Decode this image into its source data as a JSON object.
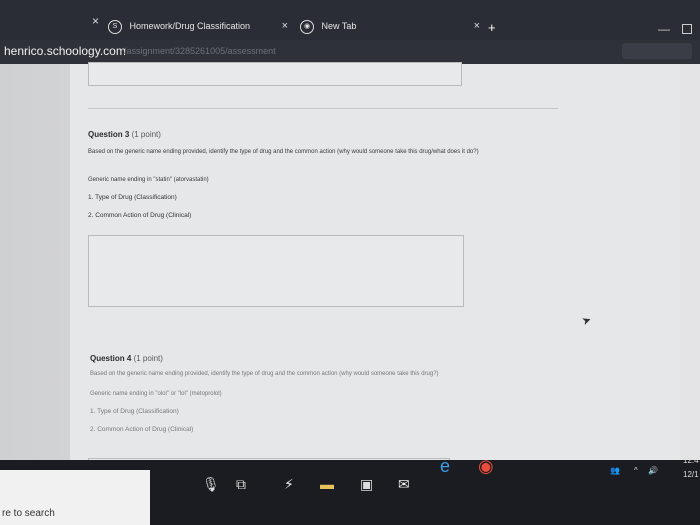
{
  "browser": {
    "tabs": [
      {
        "label": "Homework/Drug Classification",
        "favicon": "S"
      },
      {
        "label": "New Tab",
        "favicon": "◉"
      }
    ],
    "new_tab_symbol": "+",
    "close_symbol": "×",
    "address": {
      "host": "henrico.schoology.com",
      "path": "/assignment/3285261005/assessment"
    }
  },
  "questions": [
    {
      "title": "Question 3",
      "points": "(1 point)",
      "prompt": "Based on the generic name ending provided, identify the type of drug and the common action (why would someone take this drug/what does it do?)",
      "ending": "Generic name ending in \"statin\" (atorvastatin)",
      "items": [
        "1. Type of Drug (Classification)",
        "2. Common Action of Drug (Clinical)"
      ]
    },
    {
      "title": "Question 4",
      "points": "(1 point)",
      "prompt": "Based on the generic name ending provided, identify the type of drug and the common action (why would someone take this drug?)",
      "ending": "Generic name ending in \"olol\" or \"lol\" (metoprolol)",
      "items": [
        "1. Type of Drug (Classification)",
        "2. Common Action of Drug (Clinical)"
      ]
    }
  ],
  "taskbar": {
    "search_text": "re to search",
    "clock_time": "12:4",
    "clock_date": "12/1",
    "icons": [
      "microphone-icon",
      "task-view-icon",
      "lightning-icon",
      "file-explorer-icon",
      "store-icon",
      "mail-icon",
      "edge-icon",
      "chrome-icon"
    ]
  }
}
